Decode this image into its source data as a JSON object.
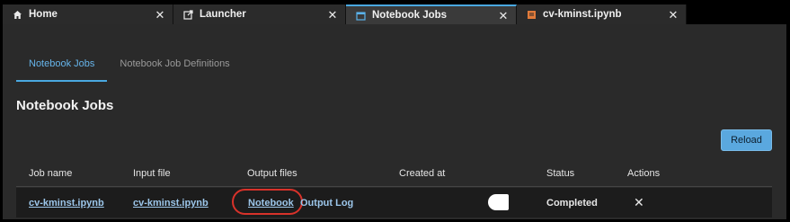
{
  "tabs": [
    {
      "label": "Home",
      "icon": "home-icon"
    },
    {
      "label": "Launcher",
      "icon": "launch-icon"
    },
    {
      "label": "Notebook Jobs",
      "icon": "calendar-icon",
      "active": true
    },
    {
      "label": "cv-kminst.ipynb",
      "icon": "notebook-icon"
    }
  ],
  "subtabs": [
    {
      "label": "Notebook Jobs",
      "active": true
    },
    {
      "label": "Notebook Job Definitions",
      "active": false
    }
  ],
  "page": {
    "title": "Notebook Jobs",
    "reload_label": "Reload"
  },
  "table": {
    "columns": [
      "Job name",
      "Input file",
      "Output files",
      "Created at",
      "Status",
      "Actions"
    ],
    "rows": [
      {
        "job_name": "cv-kminst.ipynb",
        "input_file": "cv-kminst.ipynb",
        "output_notebook": "Notebook",
        "output_log": "Output Log",
        "created_at": "",
        "status": "Completed",
        "action_icon": "close-icon"
      }
    ]
  },
  "colors": {
    "accent": "#4aa8e0",
    "reload_button": "#5aa8df",
    "highlight_circle": "#d8322a",
    "link": "#9cc6ea"
  }
}
